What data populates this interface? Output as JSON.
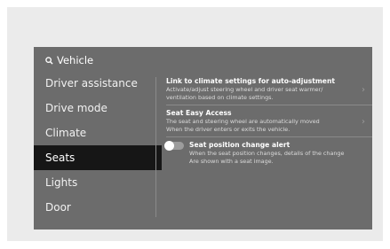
{
  "header": {
    "title": "Vehicle",
    "search_icon": "search-icon"
  },
  "menu": {
    "items": [
      {
        "label": "Driver assistance",
        "selected": false
      },
      {
        "label": "Drive mode",
        "selected": false
      },
      {
        "label": "Climate",
        "selected": false
      },
      {
        "label": "Seats",
        "selected": true
      },
      {
        "label": "Lights",
        "selected": false
      },
      {
        "label": "Door",
        "selected": false
      }
    ]
  },
  "settings": {
    "climate_link": {
      "title": "Link to climate settings for auto-adjustment",
      "desc_line1": "Activate/adjust steering wheel and driver seat warmer/",
      "desc_line2": "ventilation based on climate settings.",
      "icon": "chevron-right-icon"
    },
    "easy_access": {
      "title": "Seat Easy Access",
      "desc_line1": "The seat and steering wheel are automatically moved",
      "desc_line2": "When the driver enters or exits the vehicle.",
      "icon": "chevron-right-icon"
    },
    "position_alert": {
      "title": "Seat position change alert",
      "desc_line1": "When the seat position changes, details of the change",
      "desc_line2": "Are shown with a seat image.",
      "toggle_state": "off"
    }
  },
  "colors": {
    "screen_bg": "#6c6c6c",
    "selected_bg": "#161616",
    "frame_bg": "#ebebeb"
  }
}
